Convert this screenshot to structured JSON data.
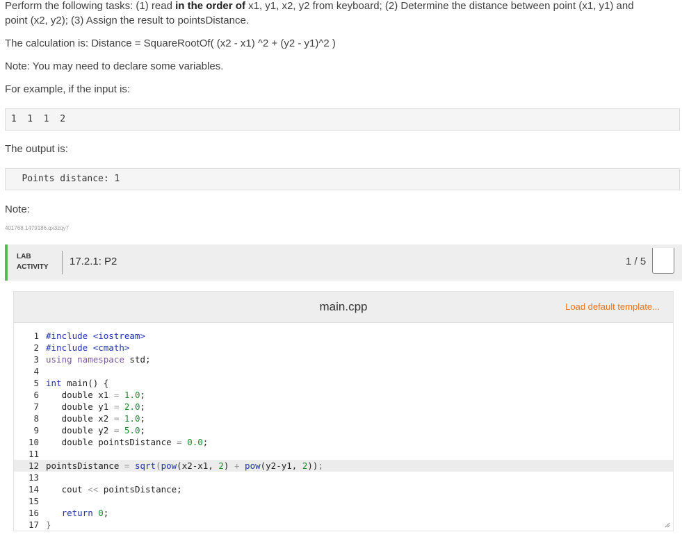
{
  "instructions": {
    "p1_before": "Perform the following tasks: (1) read ",
    "p1_bold": "in the order of",
    "p1_line1_after": " x1, y1, x2, y2 from keyboard; (2) Determine the distance between point (x1, y1) and",
    "p1_line2": "point (x2, y2); (3) Assign the result to pointsDistance.",
    "calculation": "The calculation is: Distance = SquareRootOf( (x2 - x1)  ^2 + (y2 - y1)^2 )",
    "note_declare": "Note: You may need to declare some variables.",
    "example_intro": "For example, if the input is:",
    "example_input": " 1  1  1  2",
    "output_intro": "The output is:",
    "example_output": "   Points distance: 1",
    "note_label": "Note:",
    "small_id": "401768.1479186.qx3zqy7"
  },
  "lab": {
    "label_line1": "LAB",
    "label_line2": "ACTIVITY",
    "title": "17.2.1: P2",
    "score": "1 / 5"
  },
  "editor": {
    "file_name": "main.cpp",
    "load_template_label": "Load default template...",
    "active_line": 12,
    "colors": {
      "keyword": "#7a5a9e",
      "number": "#1a8a2a",
      "operator": "#999999",
      "brace": "#777777",
      "label": "#2233aa"
    },
    "lines": [
      {
        "n": "1",
        "tokens": [
          {
            "t": "#include <iostream>",
            "c": "label"
          }
        ]
      },
      {
        "n": "2",
        "tokens": [
          {
            "t": "#include <cmath>",
            "c": "label"
          }
        ]
      },
      {
        "n": "3",
        "tokens": [
          {
            "t": "using namespace",
            "c": "keyword"
          },
          {
            "t": " std;",
            "c": ""
          }
        ]
      },
      {
        "n": "4",
        "tokens": []
      },
      {
        "n": "5",
        "tokens": [
          {
            "t": "int",
            "c": "label"
          },
          {
            "t": " main() {",
            "c": ""
          }
        ]
      },
      {
        "n": "6",
        "tokens": [
          {
            "t": "   double x1 ",
            "c": ""
          },
          {
            "t": "=",
            "c": "operator"
          },
          {
            "t": " ",
            "c": ""
          },
          {
            "t": "1.0",
            "c": "number"
          },
          {
            "t": ";",
            "c": ""
          }
        ]
      },
      {
        "n": "7",
        "tokens": [
          {
            "t": "   double y1 ",
            "c": ""
          },
          {
            "t": "=",
            "c": "operator"
          },
          {
            "t": " ",
            "c": ""
          },
          {
            "t": "2.0",
            "c": "number"
          },
          {
            "t": ";",
            "c": ""
          }
        ]
      },
      {
        "n": "8",
        "tokens": [
          {
            "t": "   double x2 ",
            "c": ""
          },
          {
            "t": "=",
            "c": "operator"
          },
          {
            "t": " ",
            "c": ""
          },
          {
            "t": "1.0",
            "c": "number"
          },
          {
            "t": ";",
            "c": ""
          }
        ]
      },
      {
        "n": "9",
        "tokens": [
          {
            "t": "   double y2 ",
            "c": ""
          },
          {
            "t": "=",
            "c": "operator"
          },
          {
            "t": " ",
            "c": ""
          },
          {
            "t": "5.0",
            "c": "number"
          },
          {
            "t": ";",
            "c": ""
          }
        ]
      },
      {
        "n": "10",
        "tokens": [
          {
            "t": "   double pointsDistance ",
            "c": ""
          },
          {
            "t": "=",
            "c": "operator"
          },
          {
            "t": " ",
            "c": ""
          },
          {
            "t": "0.0",
            "c": "number"
          },
          {
            "t": ";",
            "c": ""
          }
        ]
      },
      {
        "n": "11",
        "tokens": []
      },
      {
        "n": "12",
        "tokens": [
          {
            "t": "pointsDistance ",
            "c": ""
          },
          {
            "t": "=",
            "c": "operator"
          },
          {
            "t": " ",
            "c": ""
          },
          {
            "t": "sqrt",
            "c": "label"
          },
          {
            "t": "(",
            "c": "brace"
          },
          {
            "t": "pow",
            "c": "label"
          },
          {
            "t": "(x2-x1, ",
            "c": ""
          },
          {
            "t": "2",
            "c": "number"
          },
          {
            "t": ") ",
            "c": ""
          },
          {
            "t": "+",
            "c": "operator"
          },
          {
            "t": " ",
            "c": ""
          },
          {
            "t": "pow",
            "c": "label"
          },
          {
            "t": "(y2-y1, ",
            "c": ""
          },
          {
            "t": "2",
            "c": "number"
          },
          {
            "t": "))",
            "c": ""
          },
          {
            "t": ";",
            "c": "brace"
          }
        ]
      },
      {
        "n": "13",
        "tokens": []
      },
      {
        "n": "14",
        "tokens": [
          {
            "t": "   cout ",
            "c": ""
          },
          {
            "t": "<<",
            "c": "operator"
          },
          {
            "t": " pointsDistance;",
            "c": ""
          }
        ]
      },
      {
        "n": "15",
        "tokens": []
      },
      {
        "n": "16",
        "tokens": [
          {
            "t": "   return",
            "c": "label"
          },
          {
            "t": " ",
            "c": ""
          },
          {
            "t": "0",
            "c": "number"
          },
          {
            "t": ";",
            "c": ""
          }
        ]
      },
      {
        "n": "17",
        "tokens": [
          {
            "t": "}",
            "c": "brace"
          }
        ]
      }
    ]
  }
}
